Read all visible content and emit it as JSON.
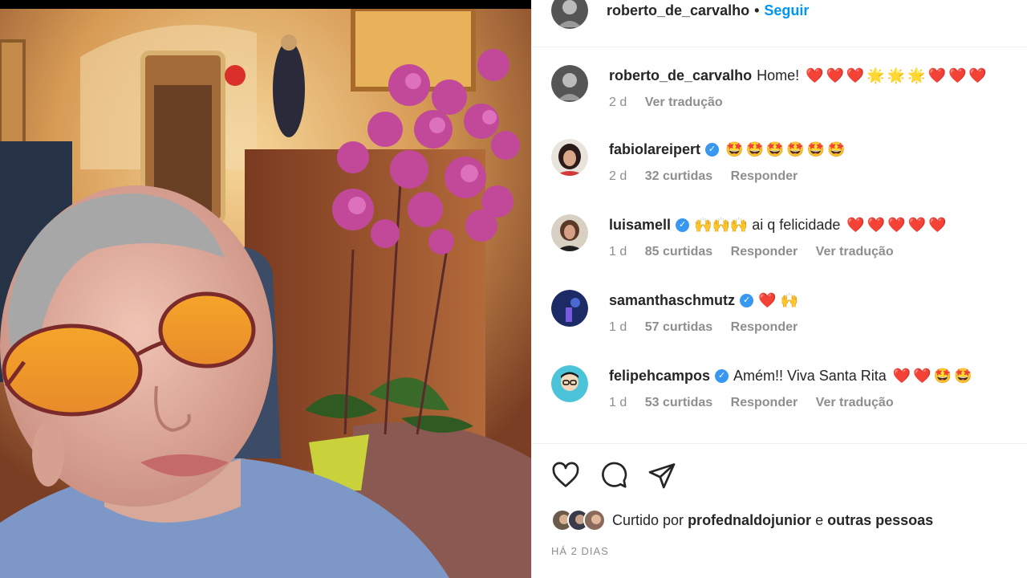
{
  "post": {
    "author": "roberto_de_carvalho",
    "follow_label": "Seguir",
    "dot": "•"
  },
  "comments": [
    {
      "username": "roberto_de_carvalho",
      "verified": false,
      "text": "Home!",
      "emoji": "❤️❤️❤️🌟🌟🌟❤️❤️❤️",
      "time": "2 d",
      "likes": "",
      "reply": "",
      "translate": "Ver tradução"
    },
    {
      "username": "fabiolareipert",
      "verified": true,
      "text": "",
      "emoji": "🤩🤩🤩🤩🤩🤩",
      "time": "2 d",
      "likes": "32 curtidas",
      "reply": "Responder",
      "translate": ""
    },
    {
      "username": "luisamell",
      "verified": true,
      "text": "🙌🙌🙌 ai q felicidade",
      "emoji": "❤️❤️❤️❤️❤️",
      "time": "1 d",
      "likes": "85 curtidas",
      "reply": "Responder",
      "translate": "Ver tradução"
    },
    {
      "username": "samanthaschmutz",
      "verified": true,
      "text": "❤️ 🙌",
      "emoji": "",
      "time": "1 d",
      "likes": "57 curtidas",
      "reply": "Responder",
      "translate": ""
    },
    {
      "username": "felipehcampos",
      "verified": true,
      "text": "Amém!! Viva Santa Rita",
      "emoji": "❤️❤️🤩🤩",
      "time": "1 d",
      "likes": "53 curtidas",
      "reply": "Responder",
      "translate": "Ver tradução"
    }
  ],
  "actions": {
    "like_icon": "heart-icon",
    "comment_icon": "comment-icon",
    "share_icon": "share-icon"
  },
  "likes": {
    "prefix": "Curtido por",
    "user": "profednaldojunior",
    "conj": "e",
    "suffix": "outras pessoas"
  },
  "posted_ago": "HÁ 2 DIAS",
  "colors": {
    "accent": "#0095f6",
    "verified": "#3897f0",
    "muted": "#8e8e8e"
  }
}
